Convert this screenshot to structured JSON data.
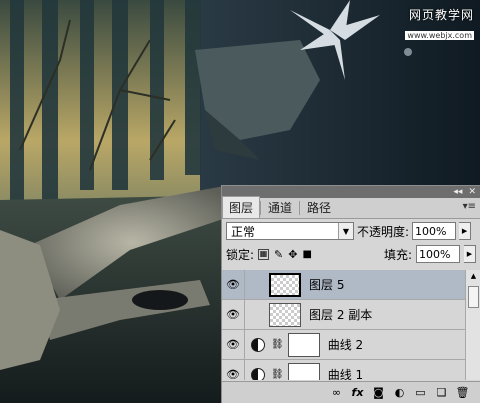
{
  "watermark": {
    "text": "网页教学网",
    "url": "www.webjx.com"
  },
  "panel": {
    "tabs": [
      "图层",
      "通道",
      "路径"
    ],
    "active_tab": "图层",
    "blend_mode": "正常",
    "opacity_label": "不透明度:",
    "opacity_value": "100%",
    "lock_label": "锁定:",
    "fill_label": "填充:",
    "fill_value": "100%",
    "layers": [
      {
        "name": "图层 5",
        "type": "pixel",
        "selected": true
      },
      {
        "name": "图层 2 副本",
        "type": "pixel",
        "selected": false
      },
      {
        "name": "曲线 2",
        "type": "adjustment",
        "selected": false
      },
      {
        "name": "曲线 1",
        "type": "adjustment",
        "selected": false
      }
    ],
    "bottom_icons": [
      "link-icon",
      "fx-icon",
      "mask-icon",
      "adjustment-icon",
      "group-icon",
      "new-layer-icon",
      "trash-icon"
    ]
  },
  "colors": {
    "panel_bg": "#d6d6d6",
    "selected_row": "#b0b9c6"
  }
}
